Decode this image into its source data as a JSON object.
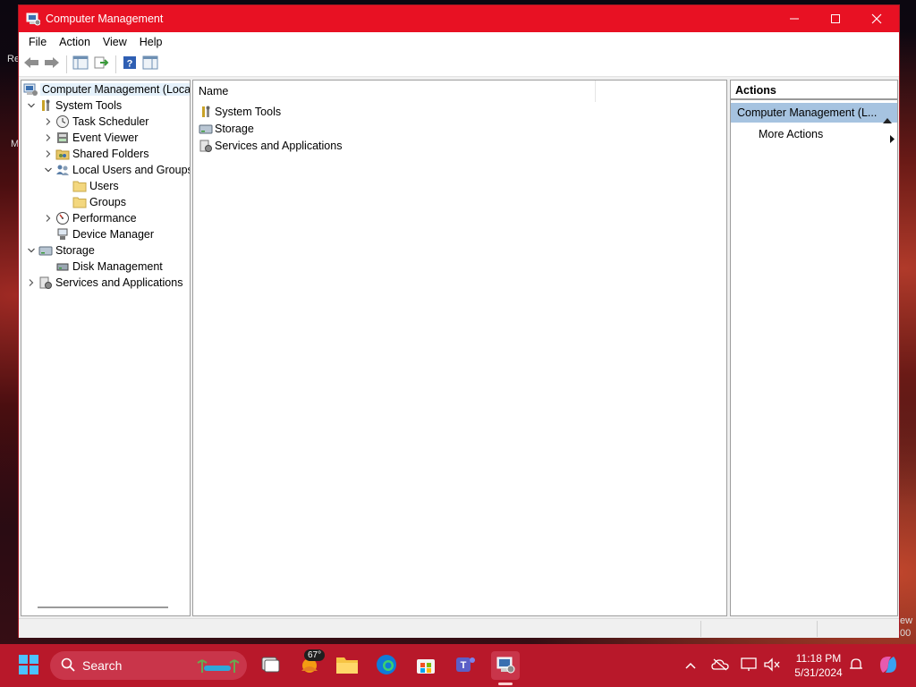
{
  "window": {
    "title": "Computer Management",
    "minimize_glyph": "—",
    "maximize_glyph": "☐",
    "close_glyph": "✕"
  },
  "menu": [
    "File",
    "Action",
    "View",
    "Help"
  ],
  "tree": {
    "root": "Computer Management (Local",
    "items": [
      {
        "label": "System Tools",
        "icon": "tools-icon"
      },
      {
        "label": "Task Scheduler",
        "icon": "clock-icon"
      },
      {
        "label": "Event Viewer",
        "icon": "event-viewer-icon"
      },
      {
        "label": "Shared Folders",
        "icon": "shared-folder-icon"
      },
      {
        "label": "Local Users and Groups",
        "icon": "users-groups-icon"
      },
      {
        "label": "Users",
        "icon": "folder-icon"
      },
      {
        "label": "Groups",
        "icon": "folder-icon"
      },
      {
        "label": "Performance",
        "icon": "performance-icon"
      },
      {
        "label": "Device Manager",
        "icon": "device-manager-icon"
      },
      {
        "label": "Storage",
        "icon": "storage-icon"
      },
      {
        "label": "Disk Management",
        "icon": "disk-icon"
      },
      {
        "label": "Services and Applications",
        "icon": "services-icon"
      }
    ]
  },
  "content": {
    "column_name": "Name",
    "rows": [
      {
        "label": "System Tools",
        "icon": "tools-icon"
      },
      {
        "label": "Storage",
        "icon": "storage-icon"
      },
      {
        "label": "Services and Applications",
        "icon": "services-icon"
      }
    ]
  },
  "actions": {
    "header": "Actions",
    "section": "Computer Management (L...",
    "more_actions": "More Actions"
  },
  "desktop_fragments": {
    "left_top": "Re",
    "left_mid": "M",
    "right_bottom_1": "ew",
    "right_bottom_2": "00"
  },
  "taskbar": {
    "search_label": "Search",
    "weather_temp": "67°",
    "time": "11:18 PM",
    "date": "5/31/2024"
  },
  "colors": {
    "titlebar": "#e81123",
    "taskbar": "#b8182a",
    "selection": "#a6c3e0"
  }
}
